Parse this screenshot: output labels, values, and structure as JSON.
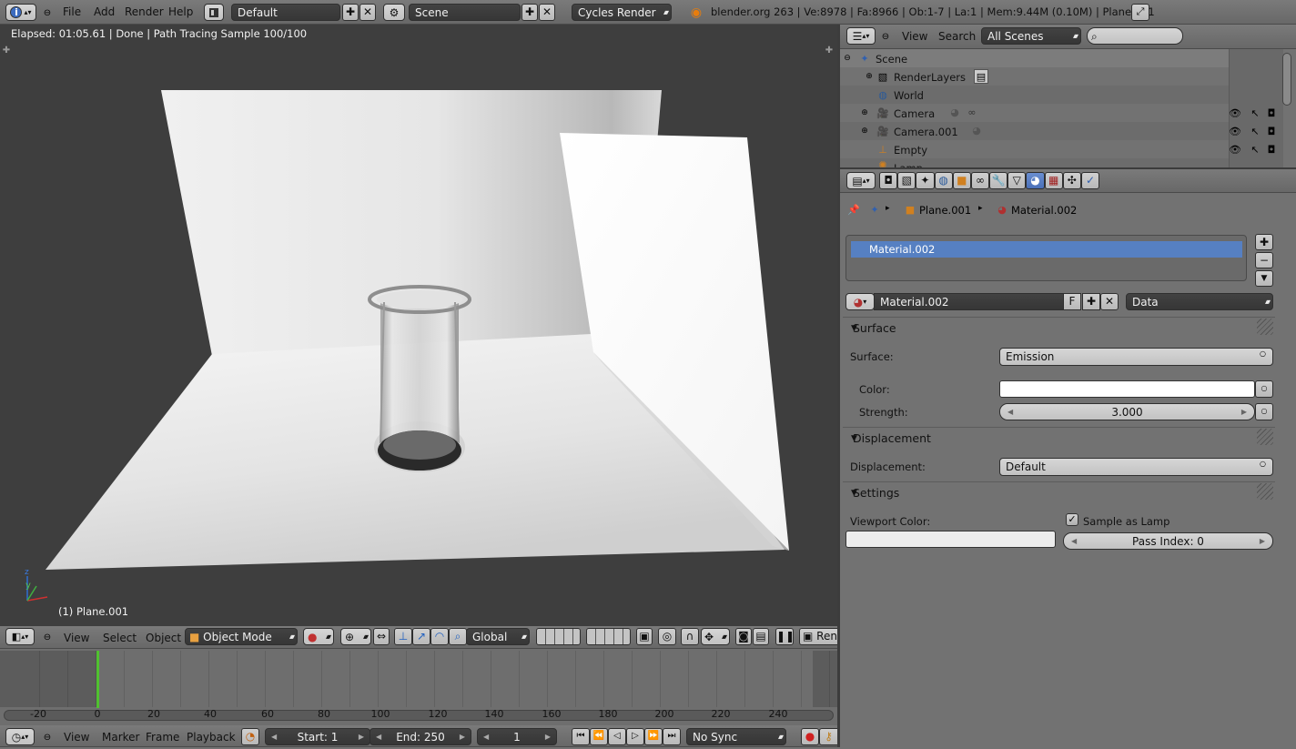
{
  "top_header": {
    "menus": [
      "File",
      "Add",
      "Render",
      "Help"
    ],
    "layout_name": "Default",
    "scene_name": "Scene",
    "engine": "Cycles Render",
    "stats": "blender.org 263 | Ve:8978 | Fa:8966 | Ob:1-7 | La:1 | Mem:9.44M (0.10M) | Plane.001"
  },
  "viewport": {
    "render_info": "Elapsed: 01:05.61 | Done | Path Tracing Sample 100/100",
    "object_label": "(1) Plane.001",
    "axis_y": "y",
    "axis_z": "z",
    "header": {
      "menus": [
        "View",
        "Select",
        "Object"
      ],
      "mode": "Object Mode",
      "orientation": "Global",
      "render_btn": "Ren"
    }
  },
  "outliner": {
    "menus": [
      "View",
      "Search"
    ],
    "display_mode": "All Scenes",
    "search_placeholder": "",
    "items": [
      {
        "label": "Scene",
        "indent": 0
      },
      {
        "label": "RenderLayers",
        "indent": 1
      },
      {
        "label": "World",
        "indent": 1
      },
      {
        "label": "Camera",
        "indent": 1
      },
      {
        "label": "Camera.001",
        "indent": 1
      },
      {
        "label": "Empty",
        "indent": 1
      },
      {
        "label": "Lamp",
        "indent": 1
      }
    ]
  },
  "properties": {
    "breadcrumb": {
      "object": "Plane.001",
      "material": "Material.002"
    },
    "material_slot": "Material.002",
    "material_name": "Material.002",
    "fake_user": "F",
    "link": "Data",
    "surface": {
      "title": "Surface",
      "surface_label": "Surface:",
      "surface_value": "Emission",
      "color_label": "Color:",
      "strength_label": "Strength:",
      "strength_value": "3.000"
    },
    "displacement": {
      "title": "Displacement",
      "label": "Displacement:",
      "value": "Default"
    },
    "settings": {
      "title": "Settings",
      "viewport_color_label": "Viewport Color:",
      "sample_as_lamp": "Sample as Lamp",
      "pass_index": "Pass Index: 0"
    },
    "colors": {
      "color_swatch": "#ffffff",
      "viewport_swatch": "#ececec",
      "selected_row": "#5680c2"
    }
  },
  "timeline": {
    "ticks": [
      "-20",
      "0",
      "20",
      "40",
      "60",
      "80",
      "100",
      "120",
      "140",
      "160",
      "180",
      "200",
      "220",
      "240"
    ],
    "current_frame_marker": "0",
    "menus": [
      "View",
      "Marker",
      "Frame",
      "Playback"
    ],
    "start": "Start: 1",
    "end": "End: 250",
    "current": "1",
    "sync": "No Sync"
  }
}
